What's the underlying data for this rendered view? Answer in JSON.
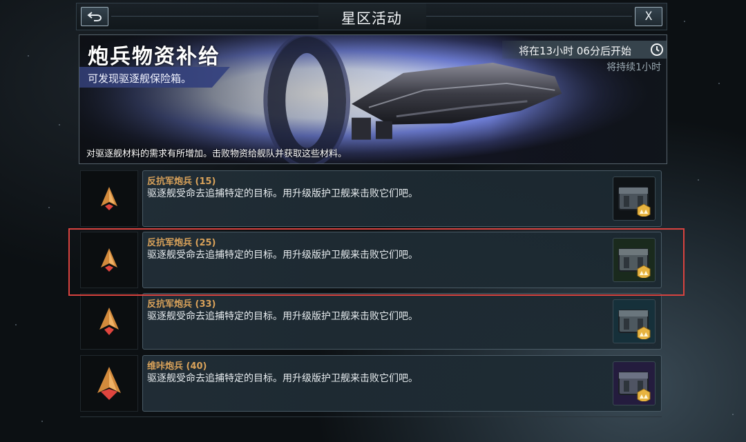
{
  "header": {
    "title": "星区活动",
    "close_label": "X"
  },
  "event": {
    "title": "炮兵物资补给",
    "subtitle": "可发现驱逐舰保险箱。",
    "start_time": "将在13小时 06分后开始",
    "duration": "将持续1小时",
    "description": "对驱逐舰材料的需求有所增加。击败物资给舰队并获取这些材料。"
  },
  "missions": [
    {
      "name": "反抗军炮兵 (15)",
      "info": "驱逐舰受命去追捕特定的目标。用升级版护卫舰来击败它们吧。",
      "reward_icon": "supply-crate-icon",
      "reward_bg": "#0f1316"
    },
    {
      "name": "反抗军炮兵 (25)",
      "info": "驱逐舰受命去追捕特定的目标。用升级版护卫舰来击败它们吧。",
      "reward_icon": "supply-crate-icon",
      "reward_bg": "#1a2a1d"
    },
    {
      "name": "反抗军炮兵 (33)",
      "info": "驱逐舰受命去追捕特定的目标。用升级版护卫舰来击败它们吧。",
      "reward_icon": "supply-crate-icon",
      "reward_bg": "#16303a"
    },
    {
      "name": "维咔炮兵 (40)",
      "info": "驱逐舰受命去追捕特定的目标。用升级版护卫舰来击败它们吧。",
      "reward_icon": "supply-crate-icon",
      "reward_bg": "#241c3e"
    }
  ],
  "colors": {
    "mission_name": "#d9a25a",
    "ribbon": "#394681",
    "highlight": "#d9433f"
  }
}
